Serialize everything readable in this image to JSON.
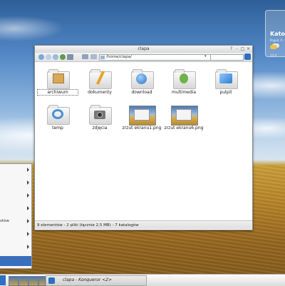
{
  "weather": {
    "city": "Katow",
    "subtitle": "Pogod. P...",
    "time": "13:4"
  },
  "window": {
    "title": "clapa",
    "address": "/home/clapa/",
    "items": [
      {
        "label": "archiwum",
        "icon": "archive-folder-icon"
      },
      {
        "label": "dokumenty",
        "icon": "documents-folder-icon"
      },
      {
        "label": "download",
        "icon": "download-folder-icon"
      },
      {
        "label": "multimedia",
        "icon": "multimedia-folder-icon"
      },
      {
        "label": "pulpit",
        "icon": "desktop-folder-icon"
      },
      {
        "label": "temp",
        "icon": "temp-folder-icon"
      },
      {
        "label": "zdjęcia",
        "icon": "photos-folder-icon"
      },
      {
        "label": "zrzut ekranu1.png",
        "icon": "image-thumbnail-icon"
      },
      {
        "label": "zrzut ekranu6.png",
        "icon": "image-thumbnail-icon"
      }
    ],
    "status": "9 elementów - 2 pliki (łącznie 2,5 MB) - 7 katalogów",
    "buttons": {
      "help": "?",
      "minimize": "-",
      "maximize": "□",
      "close": "×"
    }
  },
  "menu": {
    "partial_label": "stów"
  },
  "taskbar": {
    "task_label": "clapa - Konqueror <2>"
  },
  "colors": {
    "accent": "#3a6fbd",
    "window_bg": "#ffffff"
  }
}
